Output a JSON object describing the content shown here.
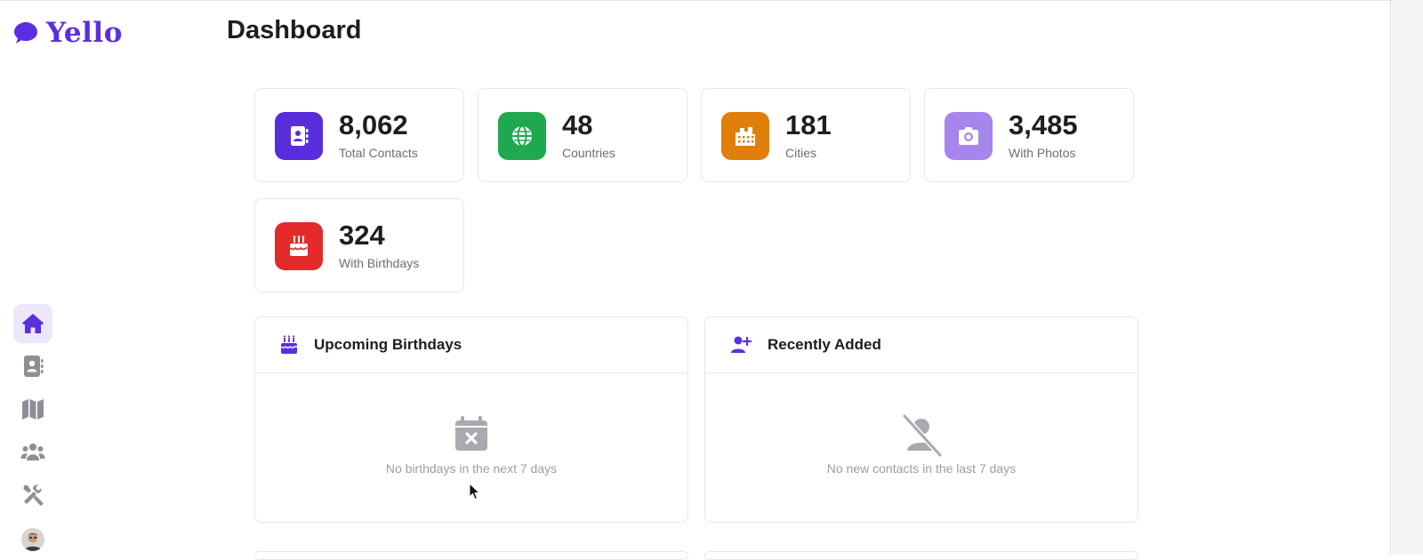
{
  "app": {
    "name": "Yello",
    "brand_color": "#5b2ee0"
  },
  "page": {
    "title": "Dashboard"
  },
  "stats": [
    {
      "value": "8,062",
      "label": "Total Contacts",
      "icon": "contacts-book-icon",
      "color": "#5a2ddc"
    },
    {
      "value": "48",
      "label": "Countries",
      "icon": "globe-icon",
      "color": "#1fa84f"
    },
    {
      "value": "181",
      "label": "Cities",
      "icon": "city-icon",
      "color": "#e07e0a"
    },
    {
      "value": "3,485",
      "label": "With Photos",
      "icon": "camera-icon",
      "color": "#a685ec"
    },
    {
      "value": "324",
      "label": "With Birthdays",
      "icon": "birthday-cake-icon",
      "color": "#e22a2a"
    }
  ],
  "panels": {
    "birthdays": {
      "title": "Upcoming Birthdays",
      "icon": "birthday-cake-icon",
      "empty_icon": "calendar-x-icon",
      "empty_text": "No birthdays in the next 7 days"
    },
    "recent": {
      "title": "Recently Added",
      "icon": "user-plus-icon",
      "empty_icon": "user-slash-icon",
      "empty_text": "No new contacts in the last 7 days"
    }
  },
  "sidebar": {
    "items": [
      {
        "name": "home",
        "icon": "home-icon",
        "active": true
      },
      {
        "name": "contacts",
        "icon": "contacts-book-icon",
        "active": false
      },
      {
        "name": "map",
        "icon": "map-icon",
        "active": false
      },
      {
        "name": "groups",
        "icon": "users-icon",
        "active": false
      },
      {
        "name": "tools",
        "icon": "tools-icon",
        "active": false
      }
    ]
  }
}
